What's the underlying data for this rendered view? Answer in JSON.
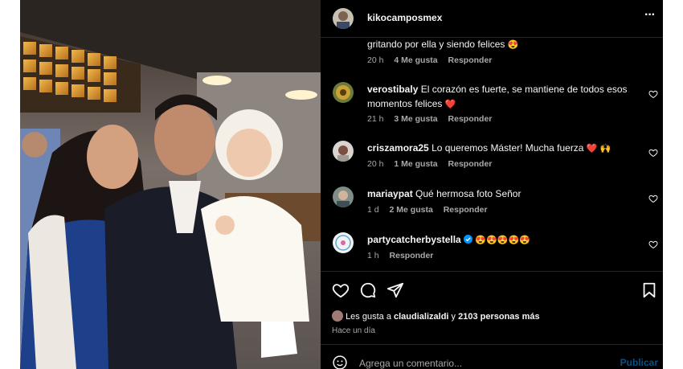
{
  "post": {
    "username": "kikocamposmex",
    "more_label": "···"
  },
  "comments": [
    {
      "username": "",
      "text": "gritando por ella y siendo felices",
      "emoji": "😍",
      "time": "20 h",
      "likes": "4 Me gusta",
      "reply": "Responder"
    },
    {
      "username": "verostibaly",
      "text": "El corazón es fuerte, se mantiene de todos esos momentos felices",
      "emoji": "❤️",
      "time": "21 h",
      "likes": "3 Me gusta",
      "reply": "Responder"
    },
    {
      "username": "criszamora25",
      "text": "Lo queremos Máster! Mucha fuerza",
      "emoji": "❤️ 🙌",
      "time": "20 h",
      "likes": "1 Me gusta",
      "reply": "Responder"
    },
    {
      "username": "mariaypat",
      "text": "Qué hermosa foto Señor",
      "emoji": "",
      "time": "1 d",
      "likes": "2 Me gusta",
      "reply": "Responder"
    },
    {
      "username": "partycatcherbystella",
      "text": "",
      "emoji": "😍😍😍😍😍",
      "time": "1 h",
      "likes": "",
      "reply": "Responder"
    }
  ],
  "likes_summary": {
    "prefix": "Les gusta a",
    "user": "claudializaldi",
    "joiner": "y",
    "others": "2103 personas más"
  },
  "posted_time": "Hace un día",
  "comment_box": {
    "placeholder": "Agrega un comentario...",
    "publish_label": "Publicar"
  },
  "colors": {
    "accent": "#0095f6",
    "verified": "#0095f6",
    "muted": "#a8a8a8",
    "heart_red": "#ed4956"
  },
  "icons": [
    "more-icon",
    "like-icon",
    "comment-icon",
    "share-icon",
    "save-icon",
    "emoji-icon",
    "verified-icon"
  ]
}
